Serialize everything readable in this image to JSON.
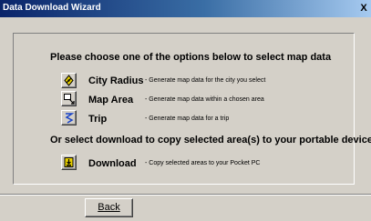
{
  "window": {
    "title": "Data Download Wizard",
    "close_label": "X"
  },
  "main": {
    "heading": "Please choose one of the options below to select map data",
    "options": [
      {
        "icon": "city-radius-icon",
        "label": "City Radius",
        "description": "- Generate map data for the city you select"
      },
      {
        "icon": "map-area-icon",
        "label": "Map Area",
        "description": "- Generate map data within a chosen area"
      },
      {
        "icon": "trip-icon",
        "label": "Trip",
        "description": "- Generate map data for a trip"
      }
    ],
    "download_heading": "Or select download to copy selected area(s) to your portable device",
    "download": {
      "icon": "download-icon",
      "label": "Download",
      "description": "- Copy selected areas to your Pocket PC"
    }
  },
  "footer": {
    "back_label": "Back"
  }
}
